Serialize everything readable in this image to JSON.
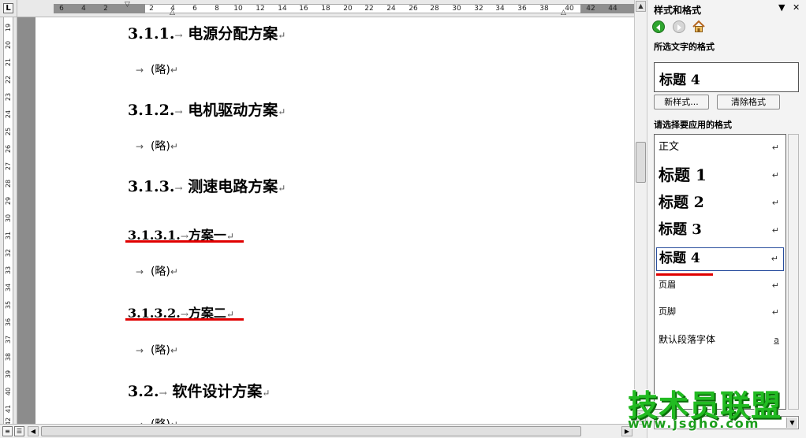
{
  "ruler": {
    "h_ticks": [
      "6",
      "4",
      "2",
      "2",
      "4",
      "6",
      "8",
      "10",
      "12",
      "14",
      "16",
      "18",
      "20",
      "22",
      "24",
      "26",
      "28",
      "30",
      "32",
      "34",
      "36",
      "38",
      "40",
      "42",
      "44"
    ],
    "v_ticks": [
      "19",
      "20",
      "21",
      "22",
      "23",
      "24",
      "25",
      "26",
      "27",
      "28",
      "29",
      "30",
      "31",
      "32",
      "33",
      "34",
      "35",
      "36",
      "37",
      "38",
      "39",
      "40",
      "41",
      "42"
    ],
    "tab_selector": "L"
  },
  "document": {
    "paragraphs": [
      {
        "style": "h3",
        "number": "3.1.1.",
        "arrow": "→",
        "text": "电源分配方案",
        "mark": "↵"
      },
      {
        "style": "body",
        "arrow": "→",
        "text": "(略)",
        "mark": "↵"
      },
      {
        "style": "h3",
        "number": "3.1.2.",
        "arrow": "→",
        "text": "电机驱动方案",
        "mark": "↵"
      },
      {
        "style": "body",
        "arrow": "→",
        "text": "(略)",
        "mark": "↵"
      },
      {
        "style": "h3",
        "number": "3.1.3.",
        "arrow": "→",
        "text": "测速电路方案",
        "mark": "↵"
      },
      {
        "style": "h4",
        "number": "3.1.3.1.",
        "arrow": "→",
        "text": "方案一",
        "mark": "↵"
      },
      {
        "style": "body",
        "arrow": "→",
        "text": "(略)",
        "mark": "↵"
      },
      {
        "style": "h4",
        "number": "3.1.3.2.",
        "arrow": "→",
        "text": "方案二",
        "mark": "↵"
      },
      {
        "style": "body",
        "arrow": "→",
        "text": "(略)",
        "mark": "↵"
      },
      {
        "style": "h3",
        "number": "3.2.",
        "arrow": "→",
        "text": "软件设计方案",
        "mark": "↵"
      },
      {
        "style": "body",
        "arrow": "→",
        "text": "(略)",
        "mark": "↵"
      }
    ]
  },
  "pane": {
    "title": "样式和格式",
    "dropdown_glyph": "▼",
    "close_glyph": "✕",
    "selected_section": "所选文字的格式",
    "selected_format": "标题 4",
    "new_style_label": "新样式...",
    "clear_format_label": "清除格式",
    "apply_section": "请选择要应用的格式",
    "styles": [
      {
        "label": "正文",
        "marker": "↵"
      },
      {
        "label": "标题 1",
        "marker": "↵"
      },
      {
        "label": "标题 2",
        "marker": "↵"
      },
      {
        "label": "标题 3",
        "marker": "↵"
      },
      {
        "label": "标题 4",
        "marker": "↵"
      },
      {
        "label": "页眉",
        "marker": "↵"
      },
      {
        "label": "页脚",
        "marker": "↵"
      },
      {
        "label": "默认段落字体",
        "marker": "a"
      }
    ]
  },
  "watermark": {
    "main": "技术员联盟",
    "url": "www.jsgho.com"
  },
  "colors": {
    "underline_red": "#e00000",
    "selection_border": "#2a4f9e",
    "watermark_green": "#22bb22"
  }
}
